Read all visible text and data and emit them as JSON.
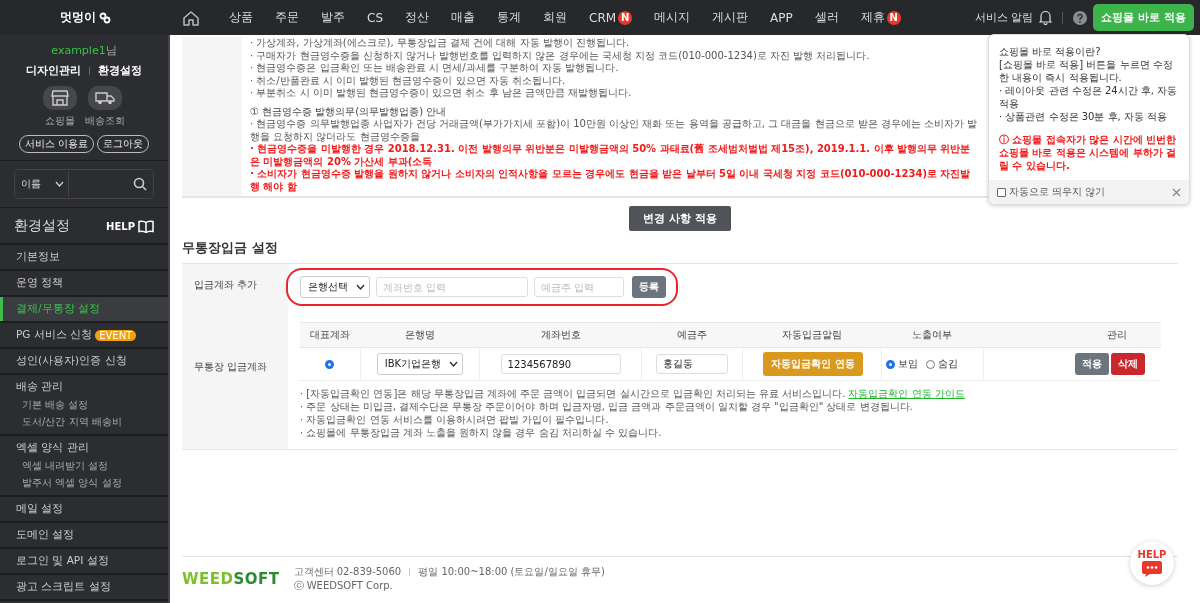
{
  "topbar": {
    "logo": "멋멍이",
    "nav": [
      {
        "label": "상품"
      },
      {
        "label": "주문"
      },
      {
        "label": "발주"
      },
      {
        "label": "CS"
      },
      {
        "label": "정산"
      },
      {
        "label": "매출"
      },
      {
        "label": "통계"
      },
      {
        "label": "회원"
      },
      {
        "label": "CRM",
        "badge": "N"
      },
      {
        "label": "메시지"
      },
      {
        "label": "게시판"
      },
      {
        "label": "APP"
      },
      {
        "label": "셀러"
      },
      {
        "label": "제휴",
        "badge": "N"
      }
    ],
    "alert_label": "서비스 알림",
    "apply_button": "쇼핑몰 바로 적용"
  },
  "sidebar": {
    "user_id": "example1",
    "user_suffix": "님",
    "links": [
      "디자인관리",
      "환경설정"
    ],
    "shortcuts": [
      {
        "kind": "store",
        "label": "쇼핑몰"
      },
      {
        "kind": "truck",
        "label": "배송조회"
      }
    ],
    "buttons": [
      "서비스 이용료",
      "로그아웃"
    ],
    "search": {
      "filter": "이름"
    },
    "section_title": "환경설정",
    "help_label": "HELP",
    "items": [
      {
        "label": "기본정보",
        "selected": false
      },
      {
        "label": "운영 정책",
        "selected": false
      },
      {
        "label": "결제/무통장 설정",
        "selected": true
      },
      {
        "label": "PG 서비스 신청",
        "badge": "EVENT",
        "selected": false
      },
      {
        "label": "성인(사용자)인증 신청",
        "selected": false
      },
      {
        "label": "배송 관리",
        "selected": false,
        "children": [
          {
            "label": "기본 배송 설정"
          },
          {
            "label": "도서/산간 지역 배송비"
          }
        ]
      },
      {
        "label": "엑셀 양식 관리",
        "selected": false,
        "children": [
          {
            "label": "엑셀 내려받기 설정"
          },
          {
            "label": "발주서 엑셀 양식 설정"
          }
        ]
      },
      {
        "label": "메일 설정",
        "selected": false
      },
      {
        "label": "도메인 설정",
        "selected": false
      },
      {
        "label": "로그인 및 API 설정",
        "selected": false
      },
      {
        "label": "광고 스크립트 설정",
        "selected": false
      }
    ]
  },
  "notice": {
    "lines": [
      {
        "kind": "normal",
        "text": "· 가상계좌, 가상계좌(에스크로), 무통장입금 결제 건에 대해 자동 발행이 진행됩니다."
      },
      {
        "kind": "normal",
        "text": "· 구매자가 현금영수증을 신청하지 않거나 발행번호를 입력하지 않은 경우에는 국세청 지정 코드(010-000-1234)로 자진 발행 처리됩니다."
      },
      {
        "kind": "normal",
        "text": "· 현금영수증은 입금확인 또는 배송완료 시 면세/과세를 구분하여 자동 발행됩니다."
      },
      {
        "kind": "normal",
        "text": "· 취소/반품완료 시 이미 발행된 현금영수증이 있으면 자동 취소됩니다."
      },
      {
        "kind": "normal",
        "text": "· 부분취소 시 이미 발행된 현금영수증이 있으면 취소 후 남은 금액만큼 재발행됩니다."
      },
      {
        "kind": "heading",
        "text": "① 현금영수증 발행의무(의무발행업종) 안내"
      },
      {
        "kind": "normal",
        "text": "· 현금영수증 의무발행업종 사업자가 건당 거래금액(부가가치세 포함)이 10만원 이상인 재화 또는 용역을 공급하고, 그 대금을 현금으로 받은 경우에는 소비자가 발행을 요청하지 않더라도 현금영수증을"
      },
      {
        "kind": "warning",
        "text": "· 현금영수증을 미발행한 경우 2018.12.31. 이전 발행의무 위반분은 미발행금액의 50% 과태료(舊 조세범처벌법 제15조), 2019.1.1. 이후 발행의무 위반분은 미발행금액의 20% 가산세 부과(소득"
      },
      {
        "kind": "warning",
        "text": "· 소비자가 현금영수증 발행을 원하지 않거나 소비자의 인적사항을 모르는 경우에도 현금을 받은 날부터 5일 이내 국세청 지정 코드(010-000-1234)로 자진발행 해야 함"
      }
    ]
  },
  "save_button": "변경 사항 적용",
  "section_title": "무통장입금 설정",
  "add_account": {
    "label": "입금계좌 추가",
    "bank_select": "은행선택",
    "account_placeholder": "계좌번호 입력",
    "holder_placeholder": "예금주 입력",
    "submit": "등록"
  },
  "accounts": {
    "label": "무통장 입금계좌",
    "columns": [
      "대표계좌",
      "은행명",
      "계좌번호",
      "예금주",
      "자동입금알림",
      "노출여부",
      "관리"
    ],
    "rows": [
      {
        "representative": true,
        "bank": "IBK기업은행",
        "account": "1234567890",
        "holder": "홍길동",
        "link_button": "자동입금확인 연동",
        "visibility": [
          {
            "label": "보임",
            "selected": true
          },
          {
            "label": "숨김",
            "selected": false
          }
        ],
        "apply": "적용",
        "delete": "삭제"
      }
    ],
    "notes": [
      {
        "text": "· [자동입금확인 연동]은 해당 무통장입금 계좌에 주문 금액이 입금되면 실시간으로 입금확인 처리되는 유료 서비스입니다.",
        "link": "자동입금확인 연동 가이드"
      },
      {
        "text": "· 주문 상태는 미입금, 결제수단은 무통장 주문이어야 하며 입금자명, 입금 금액과 주문금액이 일치할 경우 \"입금확인\" 상태로 변경됩니다."
      },
      {
        "text": "· 자동입금확인 연동 서비스를 이용하시려면 팝빌 가입이 필수입니다."
      },
      {
        "text": "· 쇼핑몰에 무통장입금 계좌 노출을 원하지 않을 경우 숨김 처리하실 수 있습니다."
      }
    ]
  },
  "popup": {
    "lines": [
      "쇼핑몰 바로 적용이란?",
      "[쇼핑몰 바로 적용] 버튼을 누르면 수정한 내용이 즉시 적용됩니다.",
      "· 레이아웃 관련 수정은 24시간 후, 자동적용",
      "· 상품관련 수정은 30분 후, 자동 적용"
    ],
    "warning": "ⓘ 쇼핑몰 접속자가 많은 시간에 빈번한 쇼핑몰 바로 적용은 시스템에 부하가 걸릴 수 있습니다.",
    "checkbox": {
      "label": "자동으로 띄우지 않기",
      "checked": false
    }
  },
  "footer": {
    "logo_primary": "WEED",
    "logo_secondary": "SOFT",
    "phone": "고객센터 02-839-5060",
    "hours": "평일 10:00~18:00 (토요일/일요일 휴무)",
    "copyright": "ⓒ WEEDSOFT Corp."
  },
  "help_fab": {
    "label": "HELP"
  }
}
